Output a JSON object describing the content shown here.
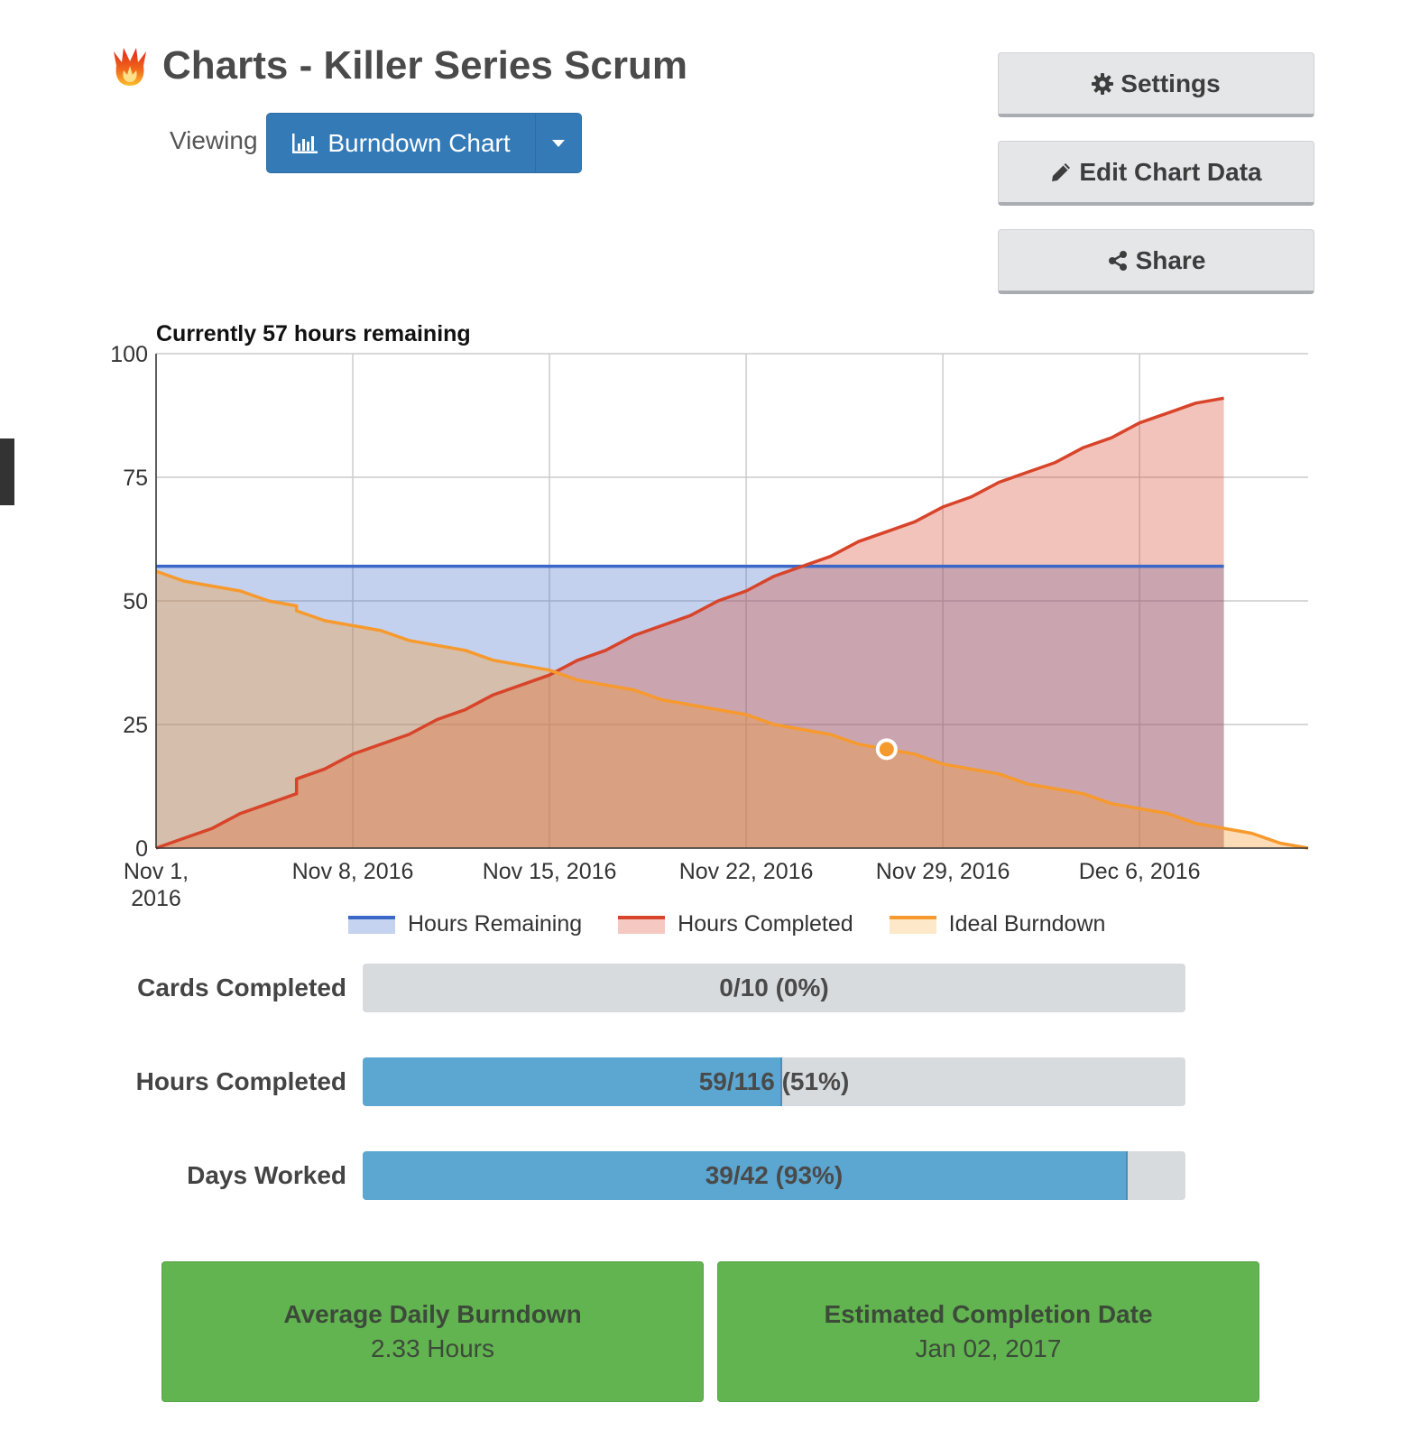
{
  "header": {
    "title": "Charts - Killer Series Scrum",
    "viewing_label": "Viewing",
    "view_selected": "Burndown Chart"
  },
  "actions": {
    "settings_label": "Settings",
    "edit_label": "Edit Chart Data",
    "share_label": "Share"
  },
  "colors": {
    "primary": "#337ab7",
    "remaining": "#3b67c8",
    "completed": "#d8442a",
    "ideal": "#f79a2e",
    "progress": "#5ba7d1",
    "success": "#62b450"
  },
  "chart_data": {
    "type": "area",
    "title": "Currently 57 hours remaining",
    "xlabel": "",
    "ylabel": "",
    "ylim": [
      0,
      100
    ],
    "yticks": [
      "0",
      "25",
      "50",
      "75",
      "100"
    ],
    "xticks": [
      "Nov 1, 2016",
      "Nov 8, 2016",
      "Nov 15, 2016",
      "Nov 22, 2016",
      "Nov 29, 2016",
      "Dec 6, 2016"
    ],
    "xrange": [
      "2016-11-01",
      "2016-12-12"
    ],
    "grid": true,
    "legend_position": "bottom",
    "series": [
      {
        "name": "Hours Remaining",
        "points": [
          [
            "2016-11-01",
            57
          ],
          [
            "2016-12-09",
            57
          ]
        ]
      },
      {
        "name": "Hours Completed",
        "points": [
          [
            "2016-11-01",
            0
          ],
          [
            "2016-11-02",
            2
          ],
          [
            "2016-11-03",
            4
          ],
          [
            "2016-11-04",
            7
          ],
          [
            "2016-11-05",
            9
          ],
          [
            "2016-11-06",
            11
          ],
          [
            "2016-11-06",
            14
          ],
          [
            "2016-11-07",
            16
          ],
          [
            "2016-11-08",
            19
          ],
          [
            "2016-11-09",
            21
          ],
          [
            "2016-11-10",
            23
          ],
          [
            "2016-11-11",
            26
          ],
          [
            "2016-11-12",
            28
          ],
          [
            "2016-11-13",
            31
          ],
          [
            "2016-11-14",
            33
          ],
          [
            "2016-11-15",
            35
          ],
          [
            "2016-11-16",
            38
          ],
          [
            "2016-11-17",
            40
          ],
          [
            "2016-11-18",
            43
          ],
          [
            "2016-11-19",
            45
          ],
          [
            "2016-11-20",
            47
          ],
          [
            "2016-11-21",
            50
          ],
          [
            "2016-11-22",
            52
          ],
          [
            "2016-11-23",
            55
          ],
          [
            "2016-11-24",
            57
          ],
          [
            "2016-11-25",
            59
          ],
          [
            "2016-11-26",
            62
          ],
          [
            "2016-11-27",
            64
          ],
          [
            "2016-11-28",
            66
          ],
          [
            "2016-11-29",
            69
          ],
          [
            "2016-11-30",
            71
          ],
          [
            "2016-12-01",
            74
          ],
          [
            "2016-12-02",
            76
          ],
          [
            "2016-12-03",
            78
          ],
          [
            "2016-12-04",
            81
          ],
          [
            "2016-12-05",
            83
          ],
          [
            "2016-12-06",
            86
          ],
          [
            "2016-12-07",
            88
          ],
          [
            "2016-12-08",
            90
          ],
          [
            "2016-12-09",
            91
          ]
        ]
      },
      {
        "name": "Ideal Burndown",
        "points": [
          [
            "2016-11-01",
            56
          ],
          [
            "2016-11-02",
            54
          ],
          [
            "2016-11-03",
            53
          ],
          [
            "2016-11-04",
            52
          ],
          [
            "2016-11-05",
            50
          ],
          [
            "2016-11-06",
            49
          ],
          [
            "2016-11-06",
            48
          ],
          [
            "2016-11-07",
            46
          ],
          [
            "2016-11-08",
            45
          ],
          [
            "2016-11-09",
            44
          ],
          [
            "2016-11-10",
            42
          ],
          [
            "2016-11-11",
            41
          ],
          [
            "2016-11-12",
            40
          ],
          [
            "2016-11-13",
            38
          ],
          [
            "2016-11-14",
            37
          ],
          [
            "2016-11-15",
            36
          ],
          [
            "2016-11-16",
            34
          ],
          [
            "2016-11-17",
            33
          ],
          [
            "2016-11-18",
            32
          ],
          [
            "2016-11-19",
            30
          ],
          [
            "2016-11-20",
            29
          ],
          [
            "2016-11-21",
            28
          ],
          [
            "2016-11-22",
            27
          ],
          [
            "2016-11-23",
            25
          ],
          [
            "2016-11-24",
            24
          ],
          [
            "2016-11-25",
            23
          ],
          [
            "2016-11-26",
            21
          ],
          [
            "2016-11-27",
            20
          ],
          [
            "2016-11-28",
            19
          ],
          [
            "2016-11-29",
            17
          ],
          [
            "2016-11-30",
            16
          ],
          [
            "2016-12-01",
            15
          ],
          [
            "2016-12-02",
            13
          ],
          [
            "2016-12-03",
            12
          ],
          [
            "2016-12-04",
            11
          ],
          [
            "2016-12-05",
            9
          ],
          [
            "2016-12-06",
            8
          ],
          [
            "2016-12-07",
            7
          ],
          [
            "2016-12-08",
            5
          ],
          [
            "2016-12-09",
            4
          ],
          [
            "2016-12-10",
            3
          ],
          [
            "2016-12-11",
            1
          ],
          [
            "2016-12-12",
            0
          ]
        ]
      }
    ],
    "highlighted_point": {
      "series": "Ideal Burndown",
      "x": "2016-11-27",
      "y": 20
    }
  },
  "stats": [
    {
      "label": "Cards Completed",
      "value": "0/10 (0%)",
      "fraction": 0
    },
    {
      "label": "Hours Completed",
      "value": "59/116 (51%)",
      "fraction": 0.51
    },
    {
      "label": "Days Worked",
      "value": "39/42 (93%)",
      "fraction": 0.93
    }
  ],
  "summary": {
    "avg_title": "Average Daily Burndown",
    "avg_value": "2.33 Hours",
    "est_title": "Estimated Completion Date",
    "est_value": "Jan 02, 2017"
  }
}
